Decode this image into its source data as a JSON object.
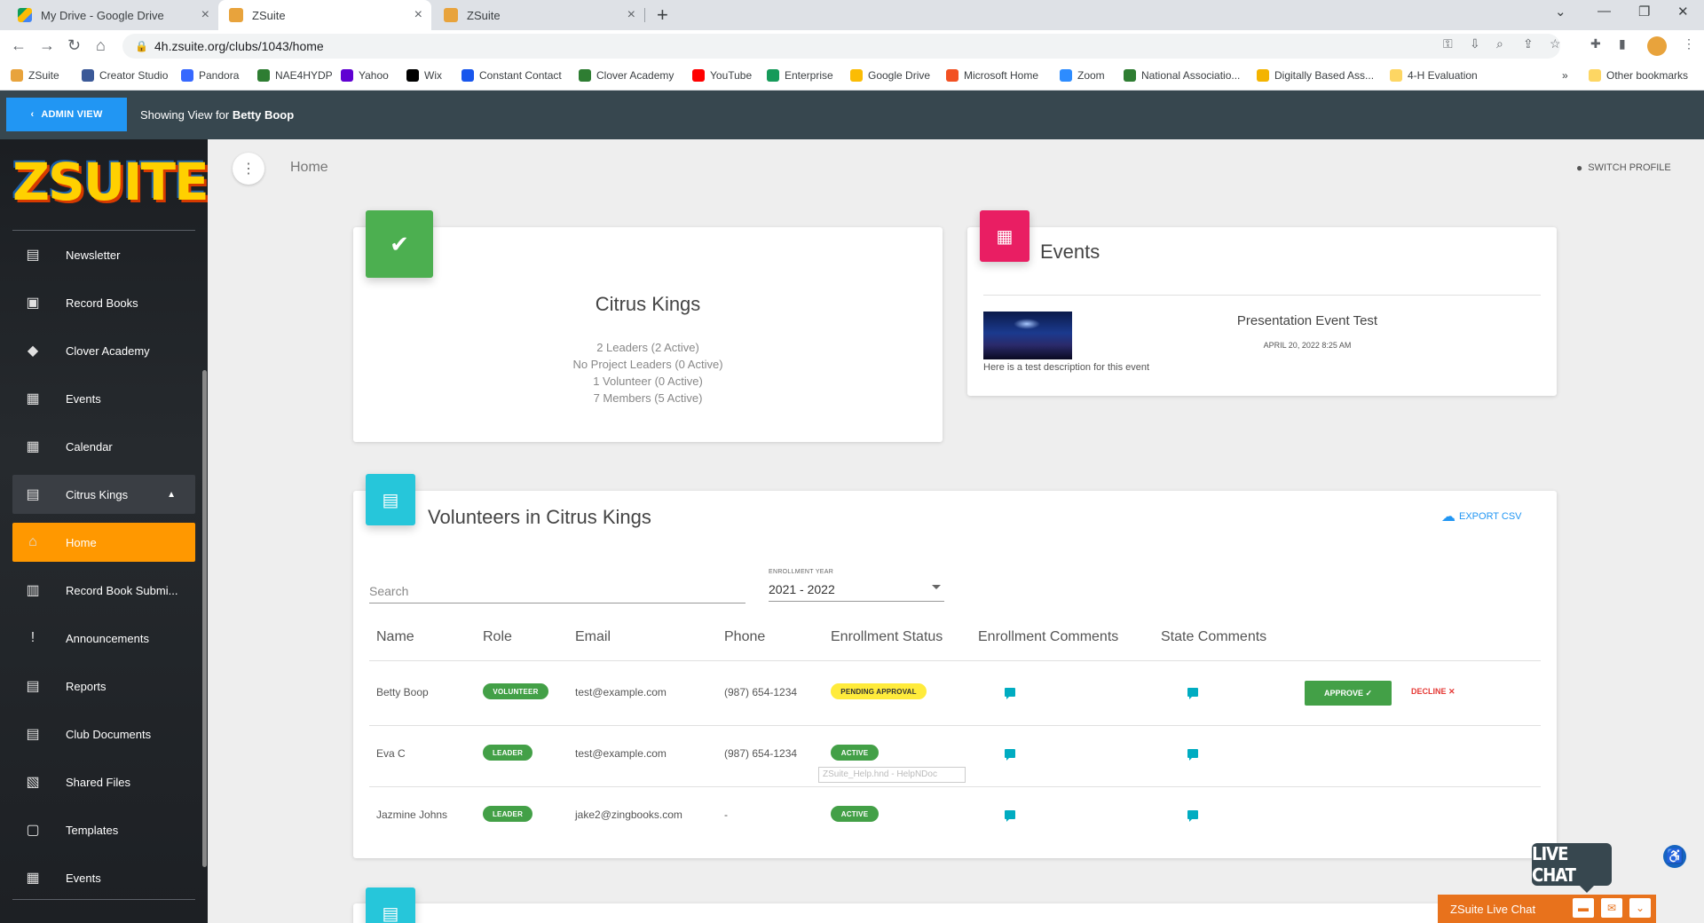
{
  "browser": {
    "tabs": [
      {
        "title": "My Drive - Google Drive",
        "active": false
      },
      {
        "title": "ZSuite",
        "active": true
      },
      {
        "title": "ZSuite",
        "active": false
      }
    ],
    "url": "4h.zsuite.org/clubs/1043/home",
    "bookmarks": [
      {
        "label": "ZSuite",
        "color": "#e8a33c"
      },
      {
        "label": "Creator Studio",
        "color": "#3b5998"
      },
      {
        "label": "Pandora",
        "color": "#3668ff"
      },
      {
        "label": "NAE4HYDP",
        "color": "#2e7d32"
      },
      {
        "label": "Yahoo",
        "color": "#6001d2"
      },
      {
        "label": "Wix",
        "color": "#000000"
      },
      {
        "label": "Constant Contact",
        "color": "#1856ed"
      },
      {
        "label": "Clover Academy",
        "color": "#2e7d32"
      },
      {
        "label": "YouTube",
        "color": "#ff0000"
      },
      {
        "label": "Enterprise",
        "color": "#169a5a"
      },
      {
        "label": "Google Drive",
        "color": "#fbbc04"
      },
      {
        "label": "Microsoft Home",
        "color": "#f25022"
      },
      {
        "label": "Zoom",
        "color": "#2d8cff"
      },
      {
        "label": "National Associatio...",
        "color": "#2e7d32"
      },
      {
        "label": "Digitally Based Ass...",
        "color": "#f4b400"
      },
      {
        "label": "4-H Evaluation",
        "color": "#fdd663"
      }
    ],
    "other_bookmarks": "Other bookmarks",
    "more": "»"
  },
  "admin_bar": {
    "button": "ADMIN VIEW",
    "showing_prefix": "Showing View for",
    "user": "Betty Boop"
  },
  "sidebar": {
    "logo": "ZSUITE",
    "items": [
      {
        "label": "Newsletter",
        "icon": "newsletter-icon",
        "glyph": "▤"
      },
      {
        "label": "Record Books",
        "icon": "record-books-icon",
        "glyph": "▣"
      },
      {
        "label": "Clover Academy",
        "icon": "graduation-cap-icon",
        "glyph": "◆"
      },
      {
        "label": "Events",
        "icon": "calendar-icon",
        "glyph": "▦"
      },
      {
        "label": "Calendar",
        "icon": "calendar-grid-icon",
        "glyph": "▦"
      },
      {
        "label": "Citrus Kings",
        "icon": "club-icon",
        "glyph": "▤"
      },
      {
        "label": "Home",
        "icon": "home-icon",
        "glyph": "⌂"
      },
      {
        "label": "Record Book Submi...",
        "icon": "submission-icon",
        "glyph": "▥"
      },
      {
        "label": "Announcements",
        "icon": "announcement-icon",
        "glyph": "!"
      },
      {
        "label": "Reports",
        "icon": "reports-icon",
        "glyph": "▤"
      },
      {
        "label": "Club Documents",
        "icon": "document-icon",
        "glyph": "▤"
      },
      {
        "label": "Shared Files",
        "icon": "files-icon",
        "glyph": "▧"
      },
      {
        "label": "Templates",
        "icon": "templates-icon",
        "glyph": "▢"
      },
      {
        "label": "Events",
        "icon": "events-icon",
        "glyph": "▦"
      }
    ]
  },
  "header": {
    "breadcrumb": "Home",
    "switch_profile": "SWITCH PROFILE"
  },
  "club_card": {
    "name": "Citrus Kings",
    "stats": [
      "2 Leaders (2 Active)",
      "No Project Leaders (0 Active)",
      "1 Volunteer (0 Active)",
      "7 Members (5 Active)"
    ],
    "icon_color": "#4caf50"
  },
  "events_card": {
    "title": "Events",
    "icon_color": "#e91e63",
    "event": {
      "name": "Presentation Event Test",
      "date": "APRIL 20, 2022 8:25 AM",
      "description": "Here is a test description for this event"
    }
  },
  "volunteers": {
    "title": "Volunteers in Citrus Kings",
    "icon_color": "#26c6da",
    "export": "EXPORT CSV",
    "search_placeholder": "Search",
    "enrollment_label": "ENROLLMENT YEAR",
    "enrollment_value": "2021 - 2022",
    "columns": [
      "Name",
      "Role",
      "Email",
      "Phone",
      "Enrollment Status",
      "Enrollment Comments",
      "State Comments"
    ],
    "rows": [
      {
        "name": "Betty Boop",
        "role": "VOLUNTEER",
        "email": "test@example.com",
        "phone": "(987) 654-1234",
        "status": "PENDING APPROVAL"
      },
      {
        "name": "Eva C",
        "role": "LEADER",
        "email": "test@example.com",
        "phone": "(987) 654-1234",
        "status": "ACTIVE"
      },
      {
        "name": "Jazmine Johns",
        "role": "LEADER",
        "email": "jake2@zingbooks.com",
        "phone": "-",
        "status": "ACTIVE"
      }
    ],
    "approve": "APPROVE ✓",
    "decline": "DECLINE ✕",
    "tooltip": "ZSuite_Help.hnd - HelpNDoc"
  },
  "live_chat": {
    "bubble": "LIVE CHAT",
    "bar": "ZSuite Live Chat"
  }
}
